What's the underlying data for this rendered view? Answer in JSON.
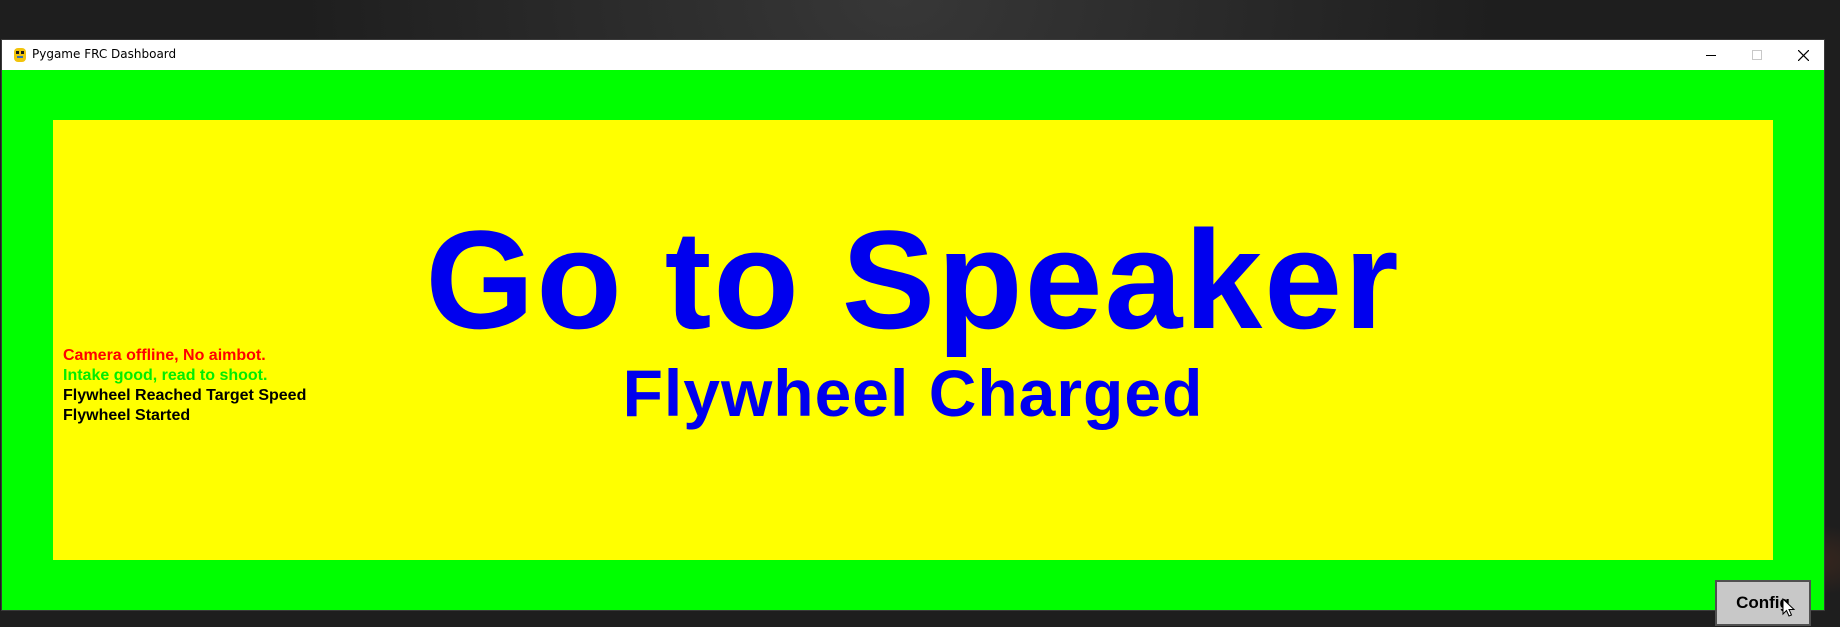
{
  "window": {
    "title": "Pygame FRC Dashboard",
    "icon": "pygame-snake-icon",
    "controls": {
      "minimize": "minimize-icon",
      "maximize": "maximize-icon",
      "close": "close-icon"
    }
  },
  "colors": {
    "border": "#00ff00",
    "panel": "#ffff00",
    "headline": "#0000ee",
    "status_error": "#ff0000",
    "status_ok": "#00ee00",
    "status_info": "#000000",
    "button": "#c8c8c8"
  },
  "dashboard": {
    "headline": "Go to Speaker",
    "subline": "Flywheel Charged",
    "status_messages": [
      {
        "text": "Camera offline, No aimbot.",
        "color": "#ff0000"
      },
      {
        "text": "Intake good, read to shoot.",
        "color": "#00ee00"
      },
      {
        "text": "Flywheel Reached Target Speed",
        "color": "#000000"
      },
      {
        "text": "Flywheel Started",
        "color": "#000000"
      }
    ],
    "config_button": "Config"
  }
}
